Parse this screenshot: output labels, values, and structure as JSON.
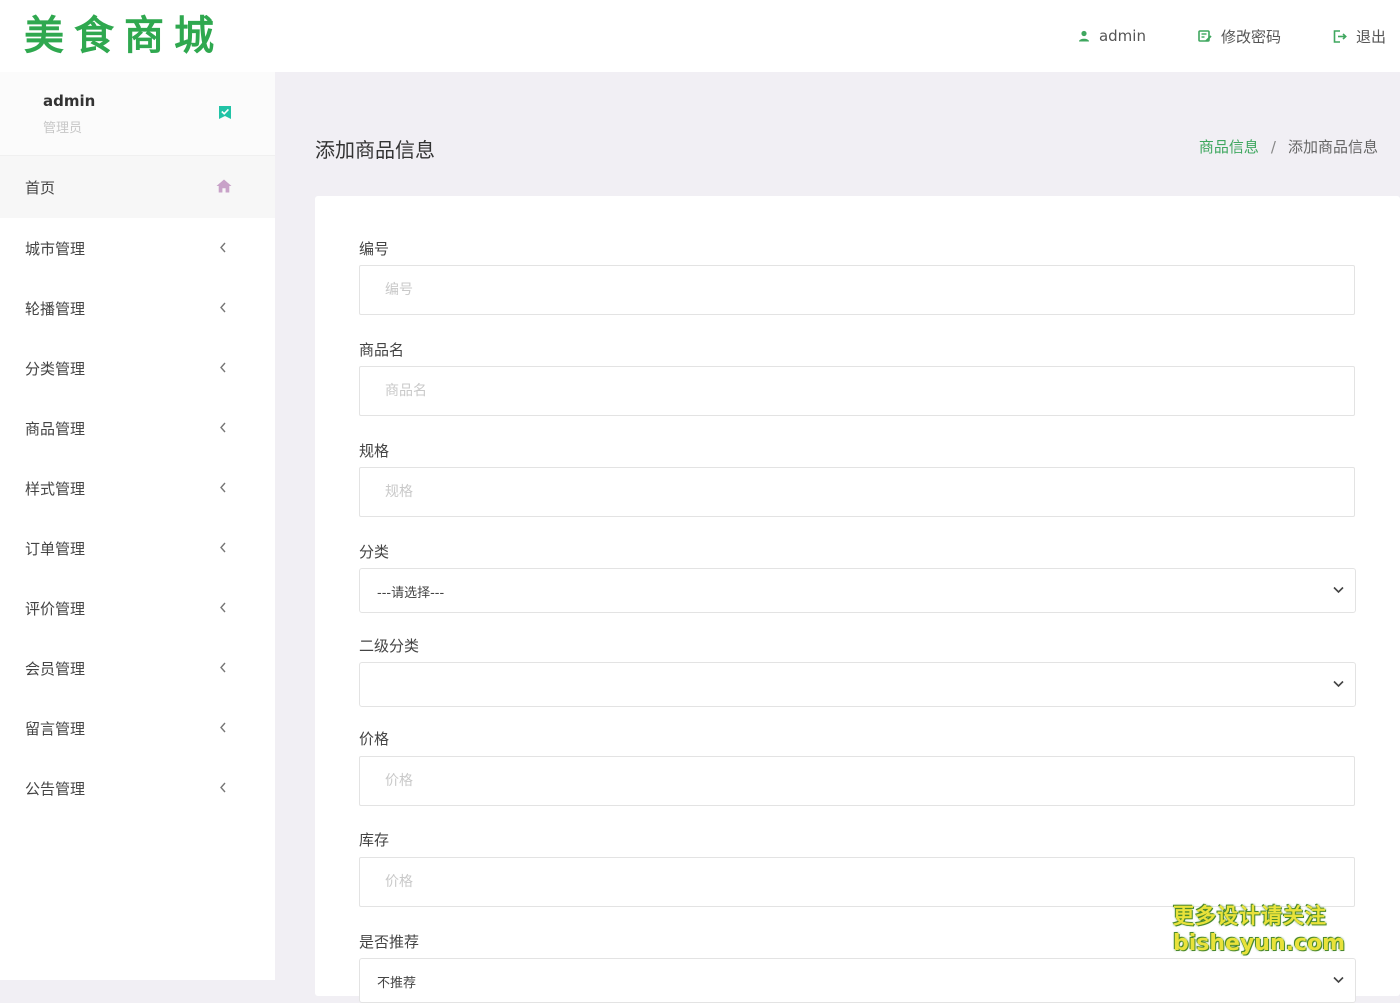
{
  "app": {
    "logo_text": "美食商城",
    "brand_color": "#2fa84f",
    "accent_color": "#3fa75f"
  },
  "topnav": {
    "user_label": "admin",
    "user_icon": "user-icon",
    "change_password_label": "修改密码",
    "change_password_icon": "edit-note-icon",
    "logout_label": "退出",
    "logout_icon": "logout-icon"
  },
  "sidebar": {
    "user": {
      "name": "admin",
      "role": "管理员",
      "badge_icon": "check-badge-icon"
    },
    "home": {
      "label": "首页",
      "icon": "home-icon"
    },
    "items": [
      {
        "label": "城市管理"
      },
      {
        "label": "轮播管理"
      },
      {
        "label": "分类管理"
      },
      {
        "label": "商品管理"
      },
      {
        "label": "样式管理"
      },
      {
        "label": "订单管理"
      },
      {
        "label": "评价管理"
      },
      {
        "label": "会员管理"
      },
      {
        "label": "留言管理"
      },
      {
        "label": "公告管理"
      }
    ]
  },
  "page": {
    "title": "添加商品信息",
    "breadcrumb": {
      "parent": "商品信息",
      "separator": "/",
      "current": "添加商品信息"
    }
  },
  "form": {
    "code": {
      "label": "编号",
      "placeholder": "编号",
      "value": ""
    },
    "name": {
      "label": "商品名",
      "placeholder": "商品名",
      "value": ""
    },
    "spec": {
      "label": "规格",
      "placeholder": "规格",
      "value": ""
    },
    "category": {
      "label": "分类",
      "selected": "---请选择---"
    },
    "subcategory": {
      "label": "二级分类",
      "selected": ""
    },
    "price": {
      "label": "价格",
      "placeholder": "价格",
      "value": ""
    },
    "stock": {
      "label": "库存",
      "placeholder": "价格",
      "value": ""
    },
    "recommend": {
      "label": "是否推荐",
      "selected": "不推荐"
    }
  },
  "watermark": {
    "line1": "更多设计请关注",
    "line2": "bisheyun.com"
  }
}
